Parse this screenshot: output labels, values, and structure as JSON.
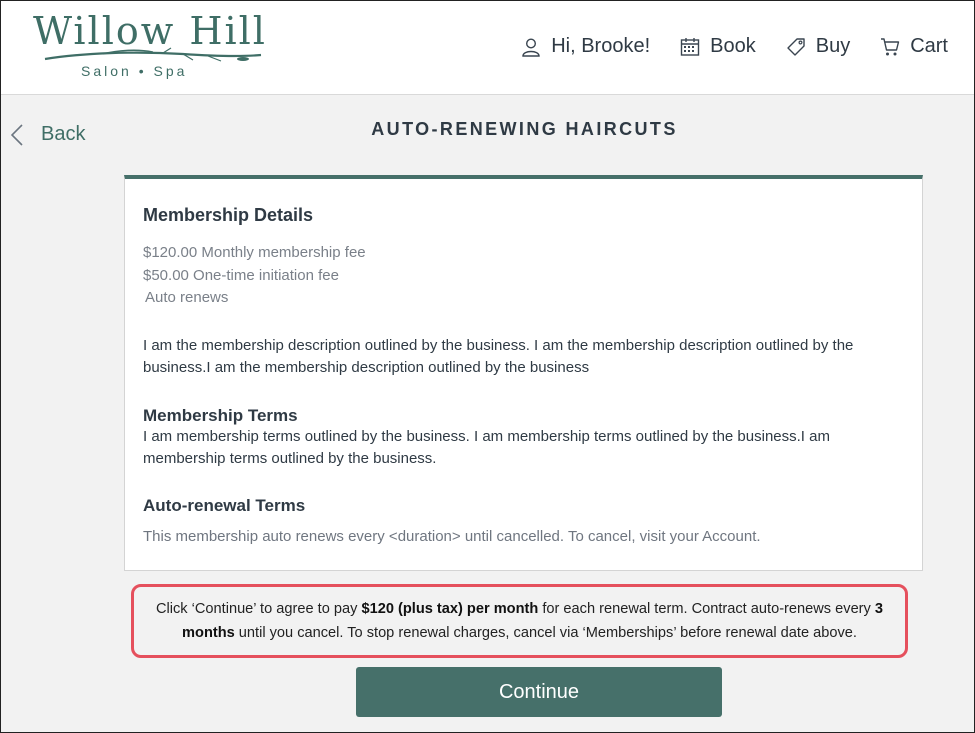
{
  "brand": {
    "name": "Willow Hill",
    "tagline": "Salon • Spa",
    "color": "#3f6e66"
  },
  "nav": {
    "greeting": "Hi, Brooke!",
    "book": "Book",
    "buy": "Buy",
    "cart": "Cart"
  },
  "back_label": "Back",
  "page_title": "AUTO-RENEWING HAIRCUTS",
  "membership": {
    "details_heading": "Membership Details",
    "monthly_fee": "$120.00 Monthly membership fee",
    "initiation_fee": "$50.00 One-time initiation fee",
    "renewal_note": "Auto renews",
    "description": "I am the membership description outlined by the business. I am the membership description outlined by the business.I am the membership description outlined by the business",
    "terms_heading": "Membership Terms",
    "terms": "I am membership terms outlined by the business. I am membership terms outlined by the business.I am membership terms outlined by the business.",
    "auto_heading": "Auto-renewal Terms",
    "auto_terms": "This membership auto renews every <duration> until cancelled. To cancel, visit your Account."
  },
  "notice": {
    "part1": "Click ‘Continue’ to agree to pay ",
    "amount": "$120 (plus tax) per month",
    "part2": " for each renewal term. Contract auto-renews every ",
    "period": "3 months",
    "part3": " until you cancel. To stop renewal charges, cancel via ‘Memberships’ before renewal date above.",
    "border_color": "#e5505d"
  },
  "continue_label": "Continue",
  "accent_color": "#46706a"
}
